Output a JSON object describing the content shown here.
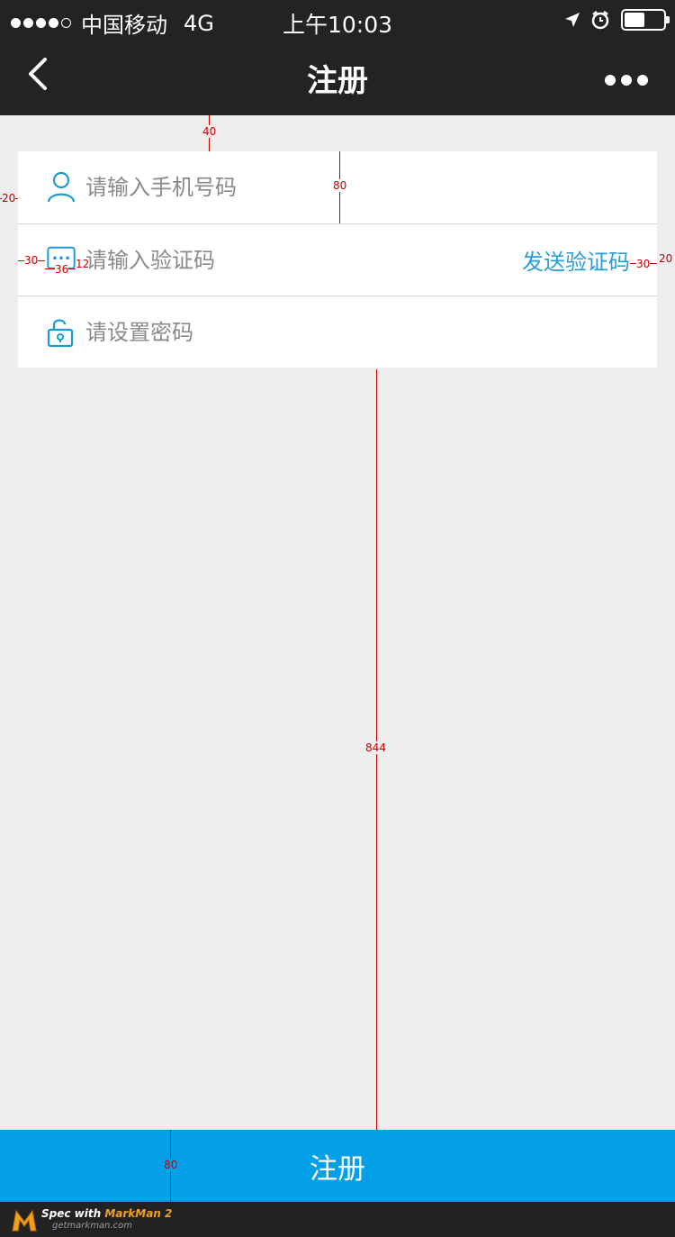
{
  "status_bar": {
    "carrier": "中国移动",
    "network": "4G",
    "time": "上午10:03",
    "battery_level": 0.45
  },
  "nav": {
    "title": "注册"
  },
  "form": {
    "phone_placeholder": "请输入手机号码",
    "code_placeholder": "请输入验证码",
    "send_code_label": "发送验证码",
    "password_placeholder": "请设置密码"
  },
  "submit_label": "注册",
  "annotations": {
    "top_gap": "40",
    "row_height": "80",
    "left_margin": "20",
    "icon_left": "30",
    "icon_size": "36",
    "icon_gap": "12",
    "right_padding": "30",
    "right_margin": "20",
    "content_gap": "844",
    "button_height": "80"
  },
  "footer": {
    "spec_prefix": "Spec with ",
    "brand": "MarkMan 2",
    "url": "getmarkman.com"
  },
  "colors": {
    "accent": "#03a0e7",
    "link": "#2a9cd9",
    "header_bg": "#232323"
  }
}
